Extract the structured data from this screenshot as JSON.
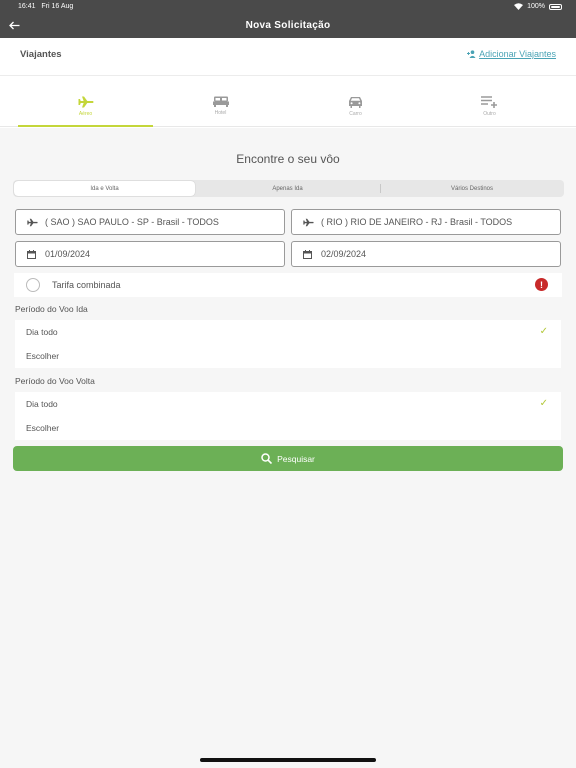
{
  "status_bar": {
    "time": "16:41",
    "date": "Fri 16 Aug",
    "battery": "100%"
  },
  "header": {
    "title": "Nova Solicitação"
  },
  "travelers": {
    "label": "Viajantes",
    "add_label": "Adicionar Viajantes"
  },
  "tabs": [
    {
      "label": "Aéreo",
      "icon": "airplane-icon",
      "active": true
    },
    {
      "label": "Hotel",
      "icon": "bed-icon",
      "active": false
    },
    {
      "label": "Carro",
      "icon": "car-icon",
      "active": false
    },
    {
      "label": "Outro",
      "icon": "playlist-add-icon",
      "active": false
    }
  ],
  "search": {
    "title": "Encontre o seu vôo",
    "trip_types": [
      "Ida e Volta",
      "Apenas Ida",
      "Vários Destinos"
    ],
    "selected_trip_type": "Ida e Volta",
    "origin": "( SAO ) SAO PAULO - SP - Brasil - TODOS",
    "destination": "( RIO ) RIO DE JANEIRO - RJ - Brasil - TODOS",
    "departure_date": "01/09/2024",
    "return_date": "02/09/2024",
    "combined_fare_label": "Tarifa combinada",
    "combined_fare_checked": false,
    "outbound_period": {
      "label": "Período do Voo Ida",
      "options": [
        "Dia todo",
        "Escolher"
      ],
      "selected": "Dia todo"
    },
    "return_period": {
      "label": "Período do Voo Volta",
      "options": [
        "Dia todo",
        "Escolher"
      ],
      "selected": "Dia todo"
    },
    "search_button_label": "Pesquisar"
  },
  "colors": {
    "header_bg": "#4a4a4a",
    "accent": "#c4d63a",
    "link": "#4aa3b5",
    "primary_button": "#6cb056",
    "alert": "#c82a2a"
  }
}
